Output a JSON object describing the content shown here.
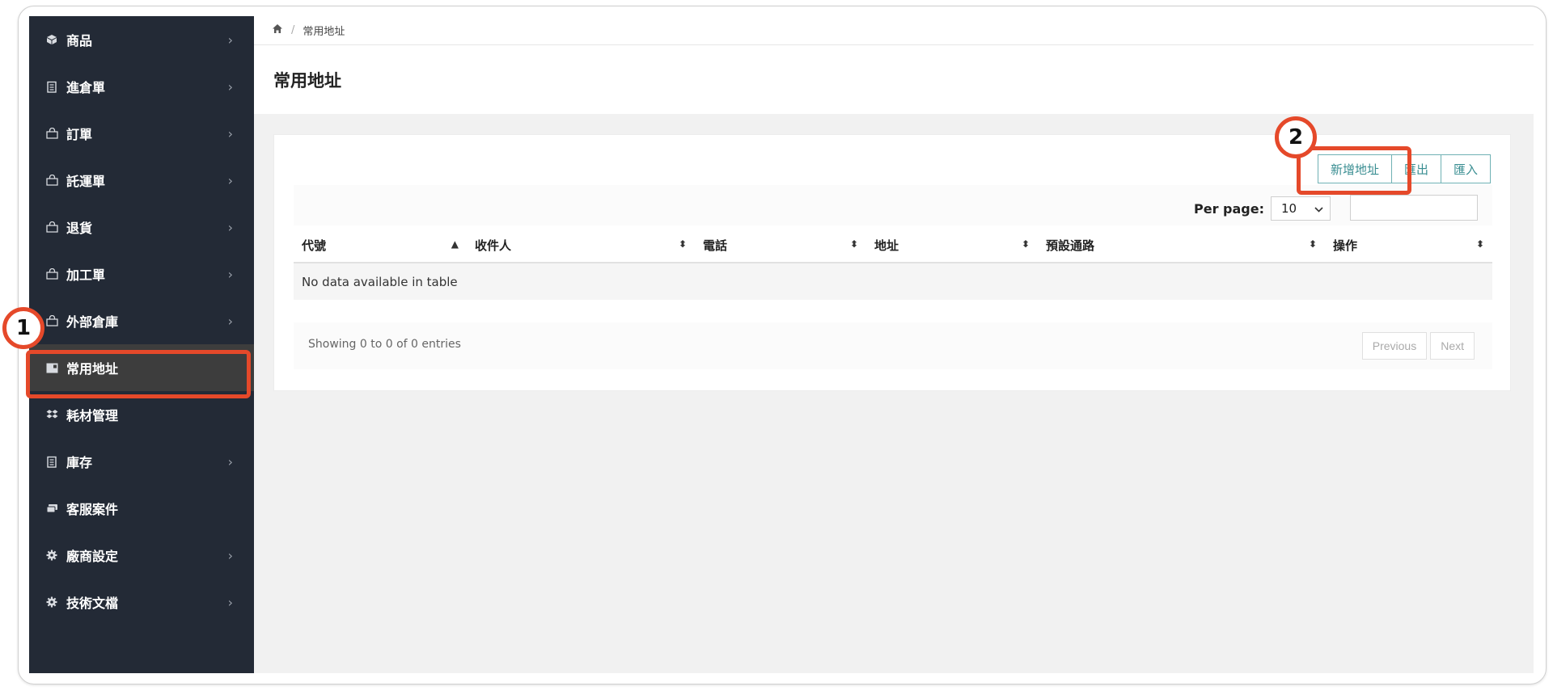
{
  "sidebar": {
    "items": [
      {
        "label": "商品",
        "icon": "box-icon",
        "chevron": "›"
      },
      {
        "label": "進倉單",
        "icon": "clipboard-icon",
        "chevron": "›"
      },
      {
        "label": "訂單",
        "icon": "shopping-bag-icon",
        "chevron": "›"
      },
      {
        "label": "託運單",
        "icon": "shopping-bag-icon",
        "chevron": "›"
      },
      {
        "label": "退貨",
        "icon": "shopping-bag-icon",
        "chevron": "›"
      },
      {
        "label": "加工單",
        "icon": "shopping-bag-icon",
        "chevron": "›"
      },
      {
        "label": "外部倉庫",
        "icon": "shopping-bag-icon",
        "chevron": "›"
      },
      {
        "label": "常用地址",
        "icon": "address-card-icon",
        "chevron": ""
      },
      {
        "label": "耗材管理",
        "icon": "dropbox-icon",
        "chevron": ""
      },
      {
        "label": "庫存",
        "icon": "clipboard-icon",
        "chevron": "›"
      },
      {
        "label": "客服案件",
        "icon": "comments-icon",
        "chevron": ""
      },
      {
        "label": "廠商設定",
        "icon": "gear-icon",
        "chevron": "›"
      },
      {
        "label": "技術文檔",
        "icon": "gear-icon",
        "chevron": "›"
      }
    ],
    "active": "常用地址"
  },
  "breadcrumb": {
    "home_icon": "home-icon",
    "separator": "/",
    "current": "常用地址"
  },
  "page": {
    "title": "常用地址"
  },
  "toolbar": {
    "add_label": "新增地址",
    "export_label": "匯出",
    "import_label": "匯入"
  },
  "table": {
    "per_page_label": "Per page:",
    "per_page_value": "10",
    "columns": [
      "代號",
      "收件人",
      "電話",
      "地址",
      "預設通路",
      "操作"
    ],
    "empty_text": "No data available in table",
    "info": "Showing 0 to 0 of 0 entries",
    "prev_label": "Previous",
    "next_label": "Next"
  },
  "annotations": {
    "step1": "1",
    "step2": "2",
    "color": "#e5492a"
  }
}
